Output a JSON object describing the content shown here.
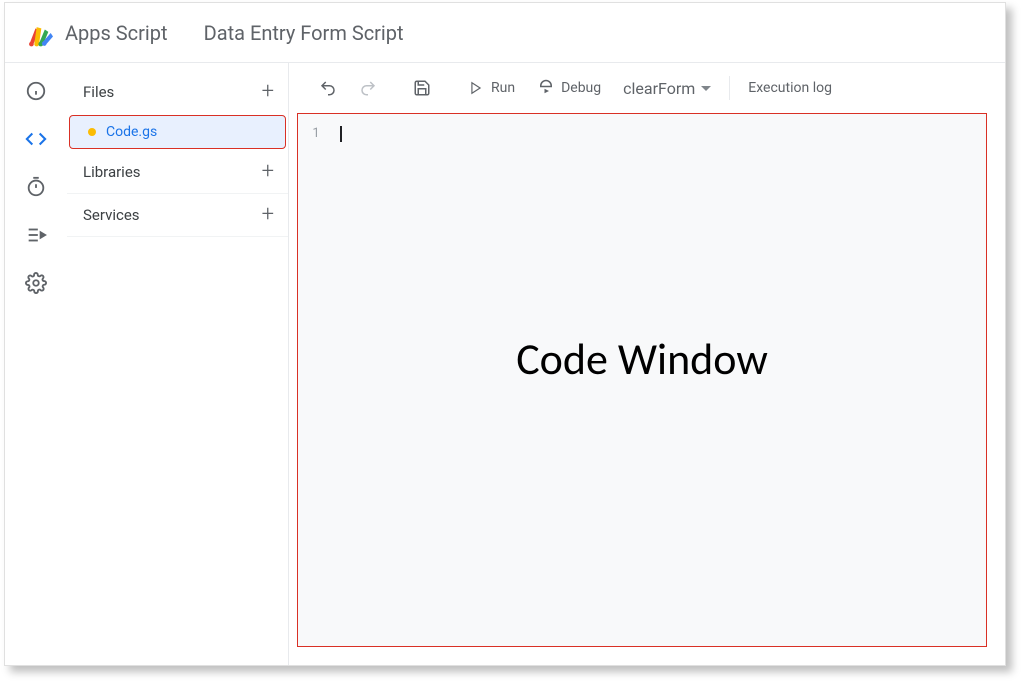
{
  "header": {
    "app_name": "Apps Script",
    "project_title": "Data Entry Form Script"
  },
  "sidebar": {
    "files_label": "Files",
    "active_file": "Code.gs",
    "libraries_label": "Libraries",
    "services_label": "Services"
  },
  "toolbar": {
    "run_label": "Run",
    "debug_label": "Debug",
    "function_selected": "clearForm",
    "execution_log_label": "Execution log"
  },
  "editor": {
    "line_number": "1"
  },
  "annotation": {
    "overlay_text": "Code Window"
  }
}
